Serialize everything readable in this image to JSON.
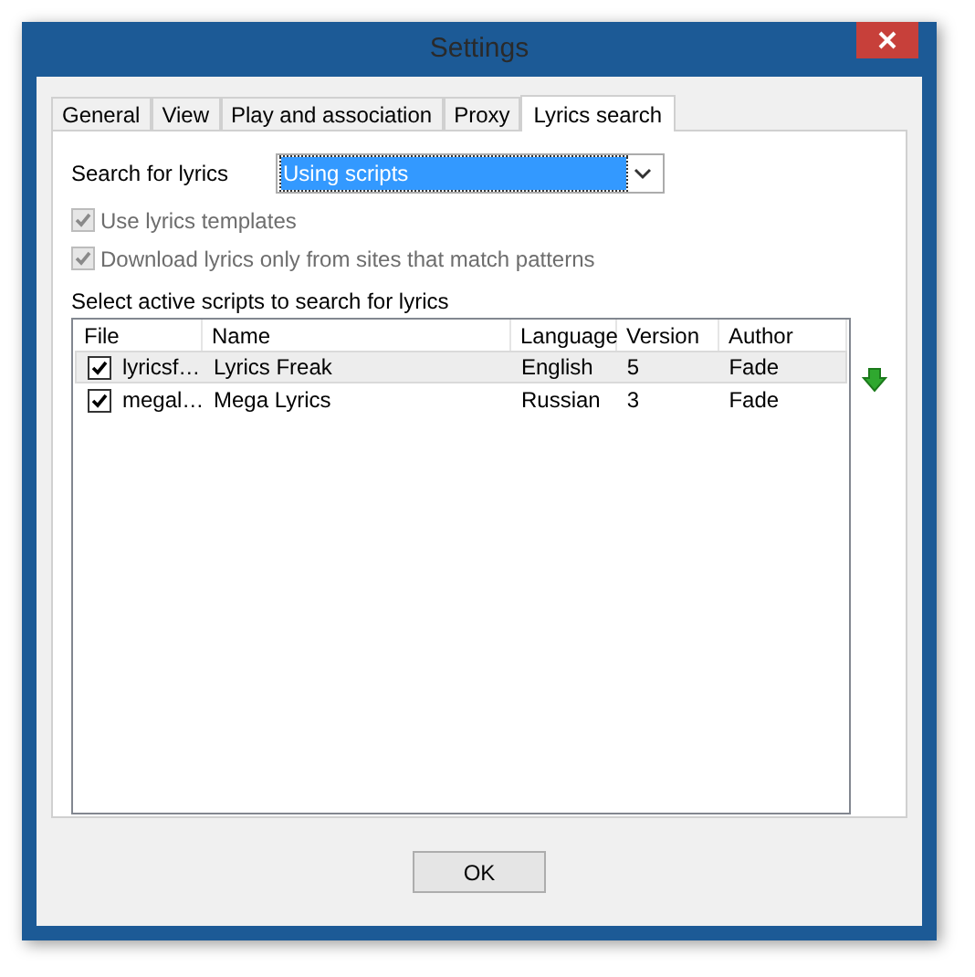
{
  "window": {
    "title": "Settings"
  },
  "tabs": [
    {
      "label": "General",
      "selected": false
    },
    {
      "label": "View",
      "selected": false
    },
    {
      "label": "Play and association",
      "selected": false
    },
    {
      "label": "Proxy",
      "selected": false
    },
    {
      "label": "Lyrics search",
      "selected": true
    }
  ],
  "search_for_lyrics": {
    "label": "Search for lyrics",
    "value": "Using scripts"
  },
  "options": [
    {
      "label": "Use lyrics templates",
      "checked": true,
      "disabled": true
    },
    {
      "label": "Download lyrics only from sites that match patterns",
      "checked": true,
      "disabled": true
    }
  ],
  "scripts_label": "Select active scripts to search for lyrics",
  "table": {
    "columns": [
      "File",
      "Name",
      "Language",
      "Version",
      "Author"
    ],
    "rows": [
      {
        "checked": true,
        "selected": true,
        "cells": [
          "lyricsf…",
          "Lyrics Freak",
          "English",
          "5",
          "Fade"
        ]
      },
      {
        "checked": true,
        "selected": false,
        "cells": [
          "megal…",
          "Mega Lyrics",
          "Russian",
          "3",
          "Fade"
        ]
      }
    ]
  },
  "buttons": [
    "OK"
  ]
}
